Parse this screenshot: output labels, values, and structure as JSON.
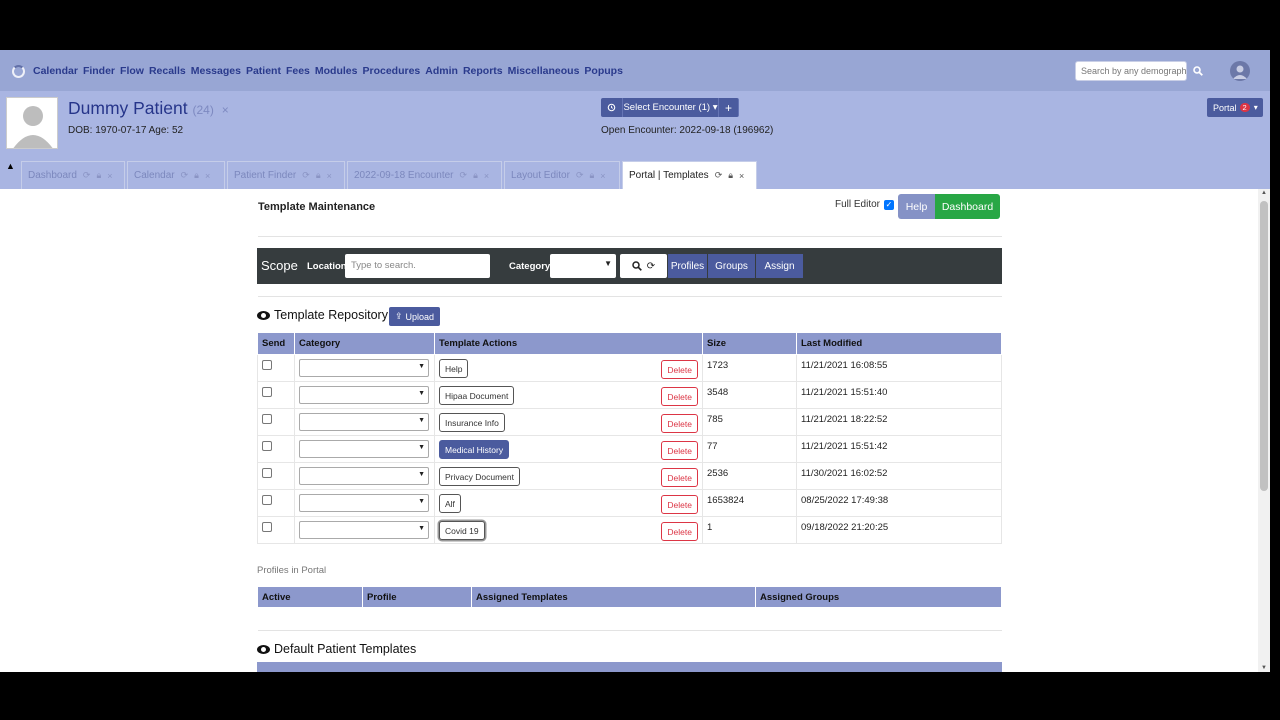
{
  "nav": {
    "menu": [
      "Calendar",
      "Finder",
      "Flow",
      "Recalls",
      "Messages",
      "Patient",
      "Fees",
      "Modules",
      "Procedures",
      "Admin",
      "Reports",
      "Miscellaneous",
      "Popups"
    ],
    "search_placeholder": "Search by any demographics"
  },
  "patient": {
    "name": "Dummy Patient",
    "age_badge": "(24)",
    "close": "×",
    "dob": "DOB: 1970-07-17 Age: 52",
    "select_encounter": "Select Encounter",
    "encounter_count": "(1)",
    "add": "+",
    "open_encounter": "Open Encounter: 2022-09-18 (196962)",
    "portal": "Portal",
    "portal_badge": "2"
  },
  "tabs": [
    "Dashboard",
    "Calendar",
    "Patient Finder",
    "2022-09-18 Encounter",
    "Layout Editor",
    "Portal | Templates"
  ],
  "page": {
    "title": "Template Maintenance",
    "full_editor": "Full Editor",
    "help": "Help",
    "dashboard": "Dashboard"
  },
  "scope": {
    "label": "Scope",
    "location_label": "Location",
    "location_placeholder": "Type to search.",
    "category_label": "Category",
    "profiles": "Profiles",
    "groups": "Groups",
    "assign": "Assign"
  },
  "repository": {
    "title": "Template Repository",
    "upload": "Upload",
    "headers": [
      "Send",
      "Category",
      "Template Actions",
      "Size",
      "Last Modified"
    ],
    "delete_label": "Delete",
    "rows": [
      {
        "name": "Help",
        "size": "1723",
        "modified": "11/21/2021 16:08:55"
      },
      {
        "name": "Hipaa Document",
        "size": "3548",
        "modified": "11/21/2021 15:51:40"
      },
      {
        "name": "Insurance Info",
        "size": "785",
        "modified": "11/21/2021 18:22:52"
      },
      {
        "name": "Medical History",
        "size": "77",
        "modified": "11/21/2021 15:51:42"
      },
      {
        "name": "Privacy Document",
        "size": "2536",
        "modified": "11/30/2021 16:02:52"
      },
      {
        "name": "Alf",
        "size": "1653824",
        "modified": "08/25/2022 17:49:38"
      },
      {
        "name": "Covid 19",
        "size": "1",
        "modified": "09/18/2022 21:20:25"
      }
    ]
  },
  "profiles": {
    "label": "Profiles in Portal",
    "headers": [
      "Active",
      "Profile",
      "Assigned Templates",
      "Assigned Groups"
    ]
  },
  "defaults": {
    "title": "Default Patient Templates"
  }
}
